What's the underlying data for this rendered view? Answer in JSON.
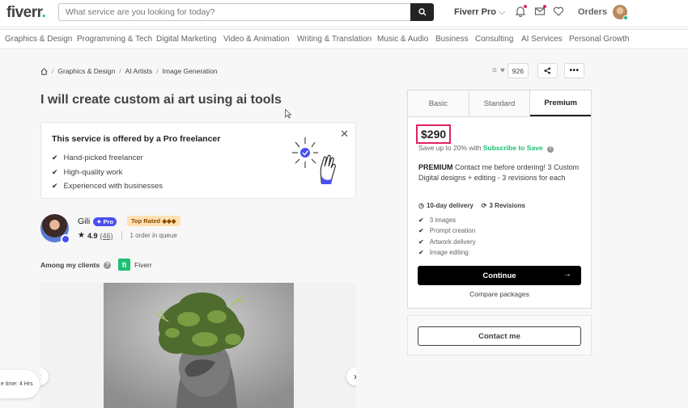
{
  "header": {
    "logo": "fiverr",
    "logo_dot": ".",
    "search_placeholder": "What service are you looking for today?",
    "fiverr_pro": "Fiverr Pro",
    "orders": "Orders"
  },
  "categories": [
    "Graphics & Design",
    "Programming & Tech",
    "Digital Marketing",
    "Video & Animation",
    "Writing & Translation",
    "Music & Audio",
    "Business",
    "Consulting",
    "AI Services",
    "Personal Growth"
  ],
  "breadcrumb": [
    "Graphics & Design",
    "AI Artists",
    "Image Generation"
  ],
  "likes_count": "926",
  "gig_title": "I will create custom ai art using ai tools",
  "pro_card": {
    "title": "This service is offered by a Pro freelancer",
    "items": [
      "Hand-picked freelancer",
      "High-quality work",
      "Experienced with businesses"
    ]
  },
  "seller": {
    "name": "Gili",
    "pro_label": "Pro",
    "top_rated": "Top Rated ◆◆◆",
    "rating": "4.9",
    "reviews": "(46)",
    "queue": "1 order in queue"
  },
  "clients": {
    "label": "Among my clients",
    "client_name": "Fiverr",
    "client_mark": "fi"
  },
  "delivery_pill": "e time: 4 Hrs",
  "package": {
    "tabs": [
      "Basic",
      "Standard",
      "Premium"
    ],
    "price": "$290",
    "save_prefix": "Save up to 20% with ",
    "save_link": "Subscribe to Save",
    "desc_title": "PREMIUM",
    "desc_body": " Contact me before ordering! 3 Custom Digital designs + editing - 3 revisions for each",
    "delivery": "10-day delivery",
    "revisions": "3 Revisions",
    "features": [
      "3 images",
      "Prompt creation",
      "Artwork delivery",
      "Image editing"
    ],
    "continue_label": "Continue",
    "compare_label": "Compare packages"
  },
  "contact_label": "Contact me",
  "colors": {
    "brand_green": "#1dbf73",
    "pro_purple": "#4a4ef0",
    "highlight_red": "#e0245e"
  }
}
